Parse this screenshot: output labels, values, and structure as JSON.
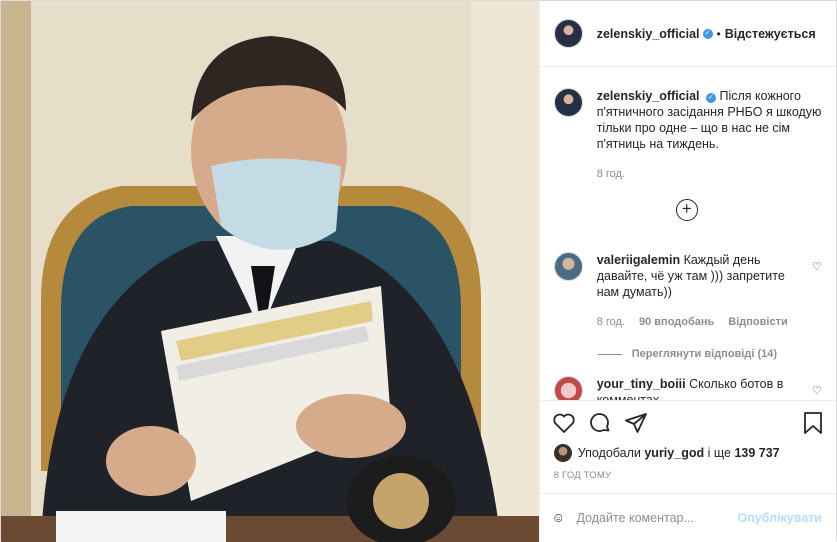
{
  "post": {
    "username": "zelenskiy_official",
    "follow_separator": "•",
    "follow_label": "Відстежується",
    "caption": "Після кожного п'ятничного засідання РНБО я шкодую тільки про одне – що в нас не сім п'ятниць на тиждень.",
    "caption_age": "8 год.",
    "load_more_icon": "plus-circle-icon",
    "likes_prefix": "Уподобали",
    "likes_user": "yuriy_god",
    "likes_joiner": "і ще",
    "likes_count": "139 737",
    "posted_time": "8 ГОД ТОМУ",
    "comment_placeholder": "Додайте коментар...",
    "publish_label": "Опублікувати"
  },
  "comments": [
    {
      "username": "valeriigalemin",
      "text": "Каждый день давайте, чё уж там ))) запретите нам думать))",
      "age": "8 год.",
      "likes": "90 вподобань",
      "reply": "Відповісти",
      "view_replies": "Переглянути відповіді (14)"
    },
    {
      "username": "your_tiny_boiii",
      "text": "Сколько ботов в комментах"
    }
  ],
  "colors": {
    "verified": "#3897f0",
    "publish_disabled": "#b2dffc",
    "secondary_text": "#8e8e8e"
  }
}
